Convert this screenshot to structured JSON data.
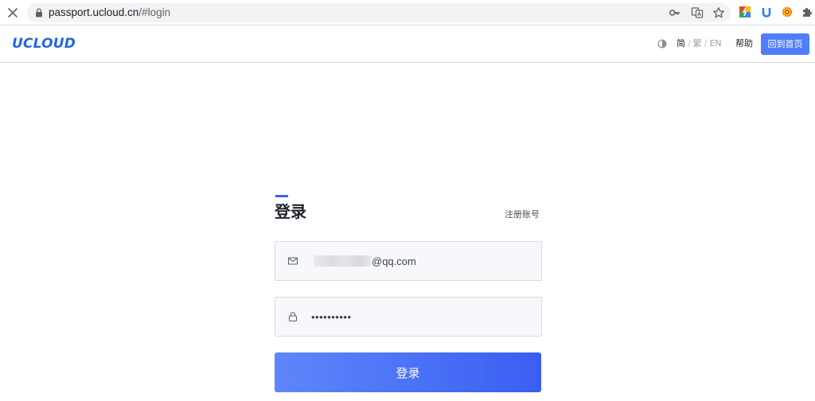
{
  "browser": {
    "url_host": "passport.ucloud.cn",
    "url_path": "/#login"
  },
  "header": {
    "logo": "UCLOUD",
    "lang_simplified": "简",
    "lang_traditional": "繁",
    "lang_english": "EN",
    "lang_separator": "/",
    "help": "帮助",
    "home_button": "回到首页"
  },
  "login": {
    "title": "登录",
    "register_link": "注册账号",
    "email_value": "@qq.com",
    "password_value": "••••••••••",
    "submit_label": "登录"
  },
  "colors": {
    "accent": "#4f7dfb",
    "logo": "#2565e6",
    "submit_gradient_start": "#5f87fb",
    "submit_gradient_end": "#3a5ef3"
  }
}
